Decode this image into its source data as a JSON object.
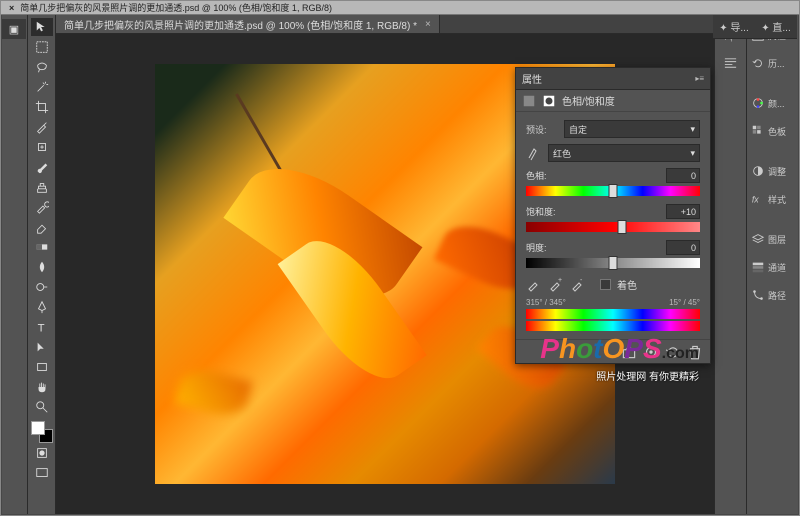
{
  "menubar": {
    "close": "×",
    "title": "简单几步把偏灰的风景照片调的更加通透.psd @ 100% (色相/饱和度 1, RGB/8)"
  },
  "document_tab": {
    "title": "简单几步把偏灰的风景照片调的更加通透.psd @ 100% (色相/饱和度 1, RGB/8) *",
    "close": "×"
  },
  "top_mini": {
    "btn1": "导...",
    "btn2": "直..."
  },
  "right_panel_items": [
    {
      "label": "属性"
    },
    {
      "label": "历..."
    },
    {
      "label": "颜..."
    },
    {
      "label": "色板"
    },
    {
      "label": "调整"
    },
    {
      "label": "样式"
    },
    {
      "label": "图层"
    },
    {
      "label": "通道"
    },
    {
      "label": "路径"
    }
  ],
  "properties": {
    "panel_tab": "属性",
    "adjustment_name": "色相/饱和度",
    "preset_label": "预设:",
    "preset_value": "自定",
    "channel_value": "红色",
    "hue_label": "色相:",
    "hue_value": "0",
    "sat_label": "饱和度:",
    "sat_value": "+10",
    "light_label": "明度:",
    "light_value": "0",
    "colorize_label": "着色",
    "range": {
      "a": "315°",
      "b": "345°",
      "c": "15°",
      "d": "45°"
    }
  },
  "watermark": {
    "t1": "P",
    "t2": "h",
    "t3": "o",
    "t4": "t",
    "tO": "O",
    "t5": "P",
    "t6": "S",
    "com": ".com",
    "sub": "照片处理网 有你更精彩"
  }
}
